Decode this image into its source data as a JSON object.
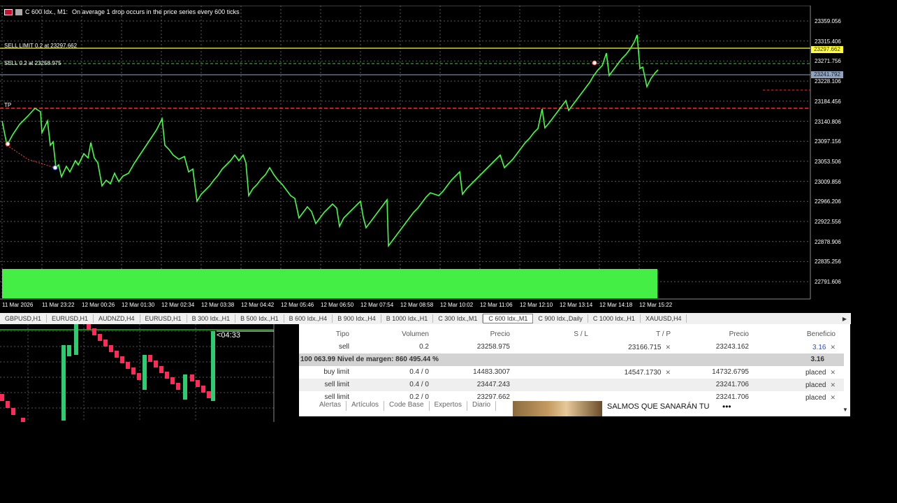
{
  "chart": {
    "title": "C 600 Idx., M1:",
    "subtitle": "On average 1 drop occurs in the price series every 600 ticks",
    "colors": {
      "line": "#44ff44",
      "sell_limit": "#ffff33",
      "tp": "#ff2a2a",
      "current_price": "#aab4c8"
    },
    "order_lines": {
      "sell_limit_label": "SELL LIMIT 0.2 at 23297.662",
      "sell_label": "SELL 0.2 at 23258.975",
      "tp_label": "TP"
    },
    "price_tags": {
      "sell_limit": "23297.662",
      "current": "23241.792"
    },
    "price_axis": [
      "23359.056",
      "23315.406",
      "23271.756",
      "23228.106",
      "23184.456",
      "23140.806",
      "23097.156",
      "23053.506",
      "23009.856",
      "22966.206",
      "22922.556",
      "22878.906",
      "22835.256",
      "22791.606"
    ],
    "time_axis": [
      "11 Mar 2026",
      "11 Mar 23:22",
      "12 Mar 00:26",
      "12 Mar 01:30",
      "12 Mar 02:34",
      "12 Mar 03:38",
      "12 Mar 04:42",
      "12 Mar 05:46",
      "12 Mar 06:50",
      "12 Mar 07:54",
      "12 Mar 08:58",
      "12 Mar 10:02",
      "12 Mar 11:06",
      "12 Mar 12:10",
      "12 Mar 13:14",
      "12 Mar 14:18",
      "12 Mar 15:22"
    ]
  },
  "chart_tabs": {
    "items": [
      "GBPUSD,H1",
      "EURUSD,H1",
      "AUDNZD,H4",
      "EURUSD,H1",
      "B 300 Idx.,H1",
      "B 500 Idx.,H1",
      "B 600 Idx.,H4",
      "B 900 Idx.,H4",
      "B 1000 Idx.,H1",
      "C 300 Idx.,M1",
      "C 600 Idx.,M1",
      "C 900 Idx.,Daily",
      "C 1000 Idx.,H1",
      "XAUUSD,H4"
    ],
    "active_index": 10
  },
  "mini_chart": {
    "countdown": "<04:33"
  },
  "terminal": {
    "headers": {
      "tipo": "Tipo",
      "volumen": "Volumen",
      "precio": "Precio",
      "sl": "S / L",
      "tp": "T / P",
      "precio2": "Precio",
      "beneficio": "Beneficio"
    },
    "position": {
      "tipo": "sell",
      "volumen": "0.2",
      "precio": "23258.975",
      "tp": "23166.715",
      "precio2": "23243.162",
      "beneficio": "3.16"
    },
    "summary": {
      "text": "100 063.99  Nivel de margen: 860 495.44 %",
      "value": "3.16"
    },
    "orders": [
      {
        "tipo": "buy limit",
        "volumen": "0.4 / 0",
        "precio": "14483.3007",
        "tp": "14547.1730",
        "precio2": "14732.6795",
        "beneficio": "placed"
      },
      {
        "tipo": "sell limit",
        "volumen": "0.4 / 0",
        "precio": "23447.243",
        "tp": "",
        "precio2": "23241.706",
        "beneficio": "placed"
      },
      {
        "tipo": "sell limit",
        "volumen": "0.2 / 0",
        "precio": "23297.662",
        "tp": "",
        "precio2": "23241.706",
        "beneficio": "placed"
      }
    ],
    "bottom_tabs": [
      "Alertas",
      "Artículos",
      "Code Base",
      "Expertos",
      "Diario"
    ],
    "ad": {
      "title": "SALMOS QUE SANARÁN TU"
    }
  }
}
